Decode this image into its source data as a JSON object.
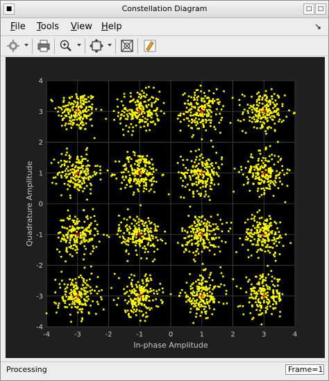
{
  "window": {
    "title": "Constellation Diagram"
  },
  "menu": {
    "items": [
      {
        "first": "F",
        "rest": "ile"
      },
      {
        "first": "T",
        "rest": "ools"
      },
      {
        "first": "V",
        "rest": "iew"
      },
      {
        "first": "H",
        "rest": "elp"
      }
    ],
    "pin_glyph": "↘"
  },
  "toolbar": {
    "icons": [
      "settings-icon",
      "print-icon",
      "zoom-in-icon",
      "scale-axes-icon",
      "measurements-icon",
      "highlight-icon"
    ]
  },
  "status": {
    "text": "Processing",
    "frame": "Frame=1"
  },
  "colors": {
    "points": "#ffff00",
    "reference": "#ff0000",
    "plot_bg": "#000000",
    "figure_bg": "#1f1f1f",
    "grid": "#3a3a3a"
  },
  "chart_data": {
    "type": "scatter",
    "title": "",
    "xlabel": "In-phase Amplitude",
    "ylabel": "Quadrature Amplitude",
    "xlim": [
      -4,
      4
    ],
    "ylim": [
      -4,
      4
    ],
    "xticks": [
      -4,
      -3,
      -2,
      -1,
      0,
      1,
      2,
      3,
      4
    ],
    "yticks": [
      -4,
      -3,
      -2,
      -1,
      0,
      1,
      2,
      3,
      4
    ],
    "grid": true,
    "series": [
      {
        "role": "received symbols",
        "cluster_centers": [
          [
            -3,
            3
          ],
          [
            -1,
            3
          ],
          [
            1,
            3
          ],
          [
            3,
            3
          ],
          [
            -3,
            1
          ],
          [
            -1,
            1
          ],
          [
            1,
            1
          ],
          [
            3,
            1
          ],
          [
            -3,
            -1
          ],
          [
            -1,
            -1
          ],
          [
            1,
            -1
          ],
          [
            3,
            -1
          ],
          [
            -3,
            -3
          ],
          [
            -1,
            -3
          ],
          [
            1,
            -3
          ],
          [
            3,
            -3
          ]
        ],
        "noise_std": 0.33,
        "points_per_cluster": 190
      },
      {
        "role": "reference constellation",
        "points": [
          [
            -3,
            3
          ],
          [
            -1,
            3
          ],
          [
            1,
            3
          ],
          [
            3,
            3
          ],
          [
            -3,
            1
          ],
          [
            -1,
            1
          ],
          [
            1,
            1
          ],
          [
            3,
            1
          ],
          [
            -3,
            -1
          ],
          [
            -1,
            -1
          ],
          [
            1,
            -1
          ],
          [
            3,
            -1
          ],
          [
            -3,
            -3
          ],
          [
            -1,
            -3
          ],
          [
            1,
            -3
          ],
          [
            3,
            -3
          ]
        ]
      }
    ]
  }
}
